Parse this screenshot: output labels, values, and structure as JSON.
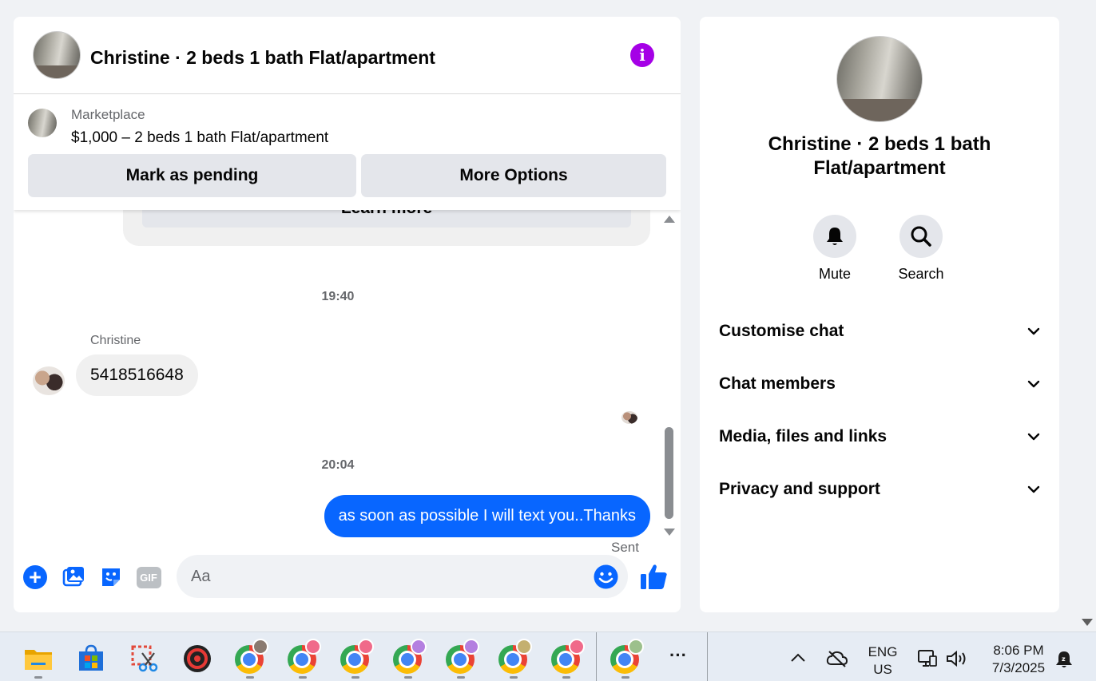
{
  "chat": {
    "title": "Christine · 2 beds 1 bath Flat/apartment",
    "listing": {
      "label": "Marketplace",
      "price_title": "$1,000 – 2 beds 1 bath Flat/apartment",
      "pending_button": "Mark as pending",
      "options_button": "More Options"
    },
    "partial_button": "Learn more",
    "messages": [
      {
        "type": "timestamp",
        "text": "19:40"
      },
      {
        "type": "incoming",
        "sender": "Christine",
        "text": "5418516648"
      },
      {
        "type": "timestamp",
        "text": "20:04"
      },
      {
        "type": "outgoing",
        "text": "as soon as possible I will text you..Thanks",
        "status": "Sent"
      }
    ],
    "composer": {
      "placeholder": "Aa"
    },
    "colors": {
      "accent": "#0866ff",
      "info": "#a500e6",
      "bubble_in": "#f0f0f0"
    }
  },
  "details": {
    "title": "Christine · 2 beds 1 bath Flat/apartment",
    "actions": [
      {
        "label": "Mute",
        "icon": "bell-icon"
      },
      {
        "label": "Search",
        "icon": "search-icon"
      }
    ],
    "sections": [
      {
        "label": "Customise chat"
      },
      {
        "label": "Chat members"
      },
      {
        "label": "Media, files and links"
      },
      {
        "label": "Privacy and support"
      }
    ]
  },
  "taskbar": {
    "gif_text": "GIF",
    "lang_top": "ENG",
    "lang_bottom": "US",
    "time": "8:06 PM",
    "date": "7/3/2025",
    "more_label": "···"
  }
}
